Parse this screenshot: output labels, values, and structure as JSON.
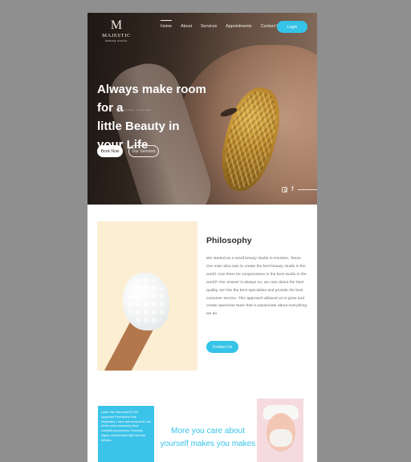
{
  "brand": {
    "mark": "M",
    "name": "MAJESTIC",
    "tagline": "beauty studio"
  },
  "nav": {
    "items": [
      "Home",
      "About",
      "Services",
      "Appointments",
      "Contact Us"
    ],
    "active": "Home",
    "login_label": "Login"
  },
  "hero": {
    "line1": "Always make room for a",
    "line2": "little Beauty in",
    "line3": "your Life",
    "subline": "beauty studio · houston texas",
    "book_label": "Book Now",
    "services_label": "Our Services",
    "social": [
      "instagram-icon",
      "facebook-icon"
    ]
  },
  "philosophy": {
    "title": "Philosophy",
    "body": "We started as a small beauty studio in Houston, Texas. Our main idea was to create the best beauty studio in the world. Can there be compromises in the best studio in the world? Our answer is always no, we care about the best quality, we hire the best specialists and provide the best customer service. This approach allowed us to grow and create awesome team that is passionate about everything we do.",
    "contact_label": "Contact Us"
  },
  "promo": {
    "box_text": "Laser Hair Removal is FDA Approved Permanent Hair Reduction. Laser hair removal is one of the most commonly done cosmetic procedures. It beams highly concentrated light into hair follicles.",
    "headline": "More you care about yourself makes you makes"
  },
  "colors": {
    "accent": "#35c3e8",
    "background": "#8f8f8f"
  }
}
